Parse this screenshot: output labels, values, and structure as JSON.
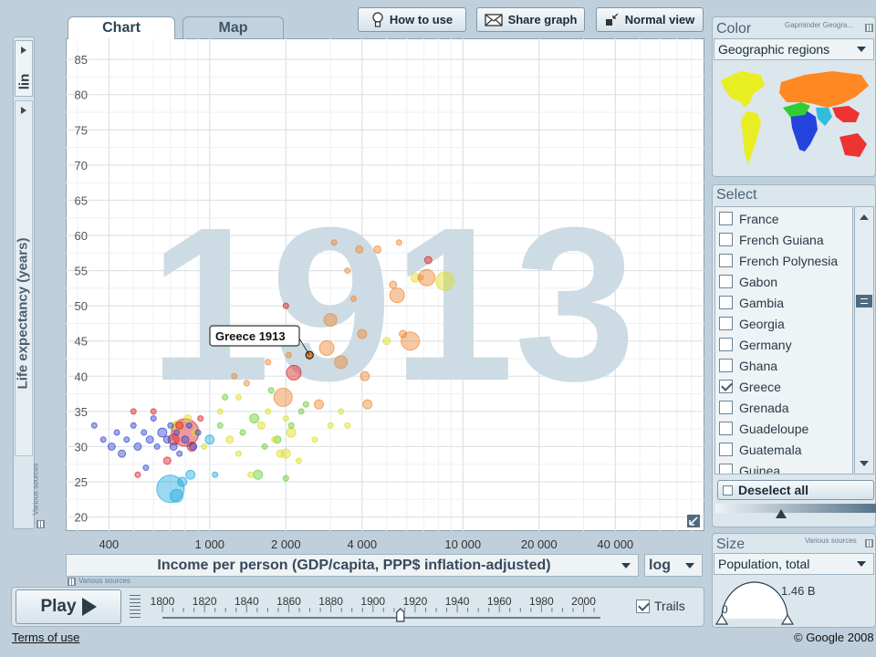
{
  "tabs": [
    {
      "label": "Chart",
      "active": true
    },
    {
      "label": "Map",
      "active": false
    }
  ],
  "toolbar": {
    "how_to_use": "How to use",
    "share_graph": "Share graph",
    "normal_view": "Normal view"
  },
  "y_scale": "lin",
  "x_scale": "log",
  "big_year": "1913",
  "tooltip": "Greece 1913",
  "sources_label": "Various sources",
  "chart_data": {
    "type": "scatter",
    "xlabel": "Income per person (GDP/capita, PPP$ inflation-adjusted)",
    "ylabel": "Life expectancy (years)",
    "x_scale": "log",
    "xlim": [
      270,
      90000
    ],
    "ylim": [
      18,
      88
    ],
    "x_ticks": [
      400,
      1000,
      2000,
      4000,
      10000,
      20000,
      40000
    ],
    "x_tick_labels": [
      "400",
      "1 000",
      "2 000",
      "4 000",
      "10 000",
      "20 000",
      "40 000"
    ],
    "y_ticks": [
      20,
      25,
      30,
      35,
      40,
      45,
      50,
      55,
      60,
      65,
      70,
      75,
      80,
      85
    ],
    "grid": true,
    "highlight": {
      "name": "Greece",
      "x": 2480,
      "y": 43
    },
    "points": [
      {
        "x": 350,
        "y": 33,
        "r": 3,
        "c": "#3344cc"
      },
      {
        "x": 380,
        "y": 31,
        "r": 3,
        "c": "#3344cc"
      },
      {
        "x": 410,
        "y": 30,
        "r": 4,
        "c": "#3344cc"
      },
      {
        "x": 430,
        "y": 32,
        "r": 3,
        "c": "#3344cc"
      },
      {
        "x": 450,
        "y": 29,
        "r": 4,
        "c": "#3344cc"
      },
      {
        "x": 470,
        "y": 31,
        "r": 3,
        "c": "#3344cc"
      },
      {
        "x": 500,
        "y": 33,
        "r": 3,
        "c": "#3344cc"
      },
      {
        "x": 520,
        "y": 30,
        "r": 4,
        "c": "#3344cc"
      },
      {
        "x": 550,
        "y": 32,
        "r": 3,
        "c": "#3344cc"
      },
      {
        "x": 580,
        "y": 31,
        "r": 4,
        "c": "#3344cc"
      },
      {
        "x": 600,
        "y": 34,
        "r": 3,
        "c": "#3344cc"
      },
      {
        "x": 620,
        "y": 30,
        "r": 3,
        "c": "#3344cc"
      },
      {
        "x": 650,
        "y": 32,
        "r": 5,
        "c": "#3344cc"
      },
      {
        "x": 680,
        "y": 31,
        "r": 4,
        "c": "#3344cc"
      },
      {
        "x": 700,
        "y": 33,
        "r": 3,
        "c": "#3344cc"
      },
      {
        "x": 720,
        "y": 30,
        "r": 4,
        "c": "#3344cc"
      },
      {
        "x": 740,
        "y": 32,
        "r": 3,
        "c": "#3344cc"
      },
      {
        "x": 760,
        "y": 29,
        "r": 3,
        "c": "#3344cc"
      },
      {
        "x": 800,
        "y": 31,
        "r": 4,
        "c": "#3344cc"
      },
      {
        "x": 830,
        "y": 33,
        "r": 3,
        "c": "#3344cc"
      },
      {
        "x": 860,
        "y": 30,
        "r": 4,
        "c": "#3344cc"
      },
      {
        "x": 900,
        "y": 32,
        "r": 3,
        "c": "#3344cc"
      },
      {
        "x": 560,
        "y": 27,
        "r": 3,
        "c": "#3344cc"
      },
      {
        "x": 600,
        "y": 35,
        "r": 3,
        "c": "#dd2222"
      },
      {
        "x": 680,
        "y": 28,
        "r": 4,
        "c": "#dd2222"
      },
      {
        "x": 720,
        "y": 31,
        "r": 6,
        "c": "#dd2222"
      },
      {
        "x": 760,
        "y": 33,
        "r": 4,
        "c": "#dd2222"
      },
      {
        "x": 800,
        "y": 32,
        "r": 15,
        "c": "#dd2222"
      },
      {
        "x": 850,
        "y": 30,
        "r": 5,
        "c": "#dd2222"
      },
      {
        "x": 920,
        "y": 34,
        "r": 3,
        "c": "#dd2222"
      },
      {
        "x": 500,
        "y": 35,
        "r": 3,
        "c": "#dd2222"
      },
      {
        "x": 520,
        "y": 26,
        "r": 3,
        "c": "#dd2222"
      },
      {
        "x": 700,
        "y": 24,
        "r": 15,
        "c": "#22aadd"
      },
      {
        "x": 740,
        "y": 23,
        "r": 7,
        "c": "#22aadd"
      },
      {
        "x": 780,
        "y": 25,
        "r": 5,
        "c": "#22aadd"
      },
      {
        "x": 840,
        "y": 26,
        "r": 5,
        "c": "#22aadd"
      },
      {
        "x": 1000,
        "y": 31,
        "r": 5,
        "c": "#22aadd"
      },
      {
        "x": 1050,
        "y": 26,
        "r": 3,
        "c": "#22aadd"
      },
      {
        "x": 740,
        "y": 33,
        "r": 5,
        "c": "#dddd22"
      },
      {
        "x": 820,
        "y": 34,
        "r": 4,
        "c": "#dddd22"
      },
      {
        "x": 880,
        "y": 32,
        "r": 4,
        "c": "#dddd22"
      },
      {
        "x": 950,
        "y": 30,
        "r": 3,
        "c": "#dddd22"
      },
      {
        "x": 1100,
        "y": 35,
        "r": 3,
        "c": "#dddd22"
      },
      {
        "x": 1200,
        "y": 31,
        "r": 4,
        "c": "#dddd22"
      },
      {
        "x": 1300,
        "y": 29,
        "r": 3,
        "c": "#dddd22"
      },
      {
        "x": 1450,
        "y": 26,
        "r": 3,
        "c": "#dddd22"
      },
      {
        "x": 1600,
        "y": 33,
        "r": 4,
        "c": "#dddd22"
      },
      {
        "x": 1700,
        "y": 35,
        "r": 3,
        "c": "#dddd22"
      },
      {
        "x": 1800,
        "y": 31,
        "r": 3,
        "c": "#dddd22"
      },
      {
        "x": 1900,
        "y": 29,
        "r": 4,
        "c": "#dddd22"
      },
      {
        "x": 2000,
        "y": 34,
        "r": 3,
        "c": "#dddd22"
      },
      {
        "x": 2100,
        "y": 32,
        "r": 5,
        "c": "#dddd22"
      },
      {
        "x": 2250,
        "y": 28,
        "r": 3,
        "c": "#dddd22"
      },
      {
        "x": 2600,
        "y": 31,
        "r": 3,
        "c": "#dddd22"
      },
      {
        "x": 3000,
        "y": 33,
        "r": 3,
        "c": "#dddd22"
      },
      {
        "x": 3300,
        "y": 35,
        "r": 3,
        "c": "#dddd22"
      },
      {
        "x": 3500,
        "y": 33,
        "r": 3,
        "c": "#dddd22"
      },
      {
        "x": 2000,
        "y": 29,
        "r": 5,
        "c": "#dddd22"
      },
      {
        "x": 1300,
        "y": 37,
        "r": 3,
        "c": "#dddd22"
      },
      {
        "x": 5000,
        "y": 45,
        "r": 4,
        "c": "#dddd22"
      },
      {
        "x": 6500,
        "y": 54,
        "r": 5,
        "c": "#dddd22"
      },
      {
        "x": 8500,
        "y": 53.5,
        "r": 10,
        "c": "#dddd22"
      },
      {
        "x": 1100,
        "y": 33,
        "r": 3,
        "c": "#66cc33"
      },
      {
        "x": 1350,
        "y": 32,
        "r": 3,
        "c": "#66cc33"
      },
      {
        "x": 1500,
        "y": 34,
        "r": 5,
        "c": "#66cc33"
      },
      {
        "x": 1650,
        "y": 30,
        "r": 3,
        "c": "#66cc33"
      },
      {
        "x": 1750,
        "y": 38,
        "r": 3,
        "c": "#66cc33"
      },
      {
        "x": 1850,
        "y": 31,
        "r": 4,
        "c": "#66cc33"
      },
      {
        "x": 2100,
        "y": 33,
        "r": 3,
        "c": "#66cc33"
      },
      {
        "x": 2300,
        "y": 35,
        "r": 3,
        "c": "#66cc33"
      },
      {
        "x": 1550,
        "y": 26,
        "r": 5,
        "c": "#66cc33"
      },
      {
        "x": 2000,
        "y": 25.5,
        "r": 3,
        "c": "#66cc33"
      },
      {
        "x": 1150,
        "y": 37,
        "r": 3,
        "c": "#66cc33"
      },
      {
        "x": 2400,
        "y": 36,
        "r": 3,
        "c": "#66cc33"
      },
      {
        "x": 1250,
        "y": 40,
        "r": 3,
        "c": "#ee8833"
      },
      {
        "x": 1400,
        "y": 39,
        "r": 3,
        "c": "#ee8833"
      },
      {
        "x": 1700,
        "y": 42,
        "r": 3,
        "c": "#ee8833"
      },
      {
        "x": 1950,
        "y": 37,
        "r": 10,
        "c": "#ee8833"
      },
      {
        "x": 2050,
        "y": 43,
        "r": 3,
        "c": "#ee8833"
      },
      {
        "x": 2700,
        "y": 36,
        "r": 5,
        "c": "#ee8833"
      },
      {
        "x": 2900,
        "y": 44,
        "r": 8,
        "c": "#ee8833"
      },
      {
        "x": 3000,
        "y": 48,
        "r": 7,
        "c": "#ee8833"
      },
      {
        "x": 3100,
        "y": 59,
        "r": 3,
        "c": "#ee8833"
      },
      {
        "x": 3300,
        "y": 42,
        "r": 7,
        "c": "#ee8833"
      },
      {
        "x": 3500,
        "y": 55,
        "r": 3,
        "c": "#ee8833"
      },
      {
        "x": 3700,
        "y": 51,
        "r": 3,
        "c": "#ee8833"
      },
      {
        "x": 3900,
        "y": 58,
        "r": 4,
        "c": "#ee8833"
      },
      {
        "x": 4000,
        "y": 46,
        "r": 5,
        "c": "#ee8833"
      },
      {
        "x": 4100,
        "y": 40,
        "r": 5,
        "c": "#ee8833"
      },
      {
        "x": 4200,
        "y": 36,
        "r": 5,
        "c": "#ee8833"
      },
      {
        "x": 4600,
        "y": 58,
        "r": 4,
        "c": "#ee8833"
      },
      {
        "x": 5300,
        "y": 53,
        "r": 4,
        "c": "#ee8833"
      },
      {
        "x": 5500,
        "y": 51.5,
        "r": 8,
        "c": "#ee8833"
      },
      {
        "x": 5800,
        "y": 46,
        "r": 4,
        "c": "#ee8833"
      },
      {
        "x": 6200,
        "y": 45,
        "r": 10,
        "c": "#ee8833"
      },
      {
        "x": 6800,
        "y": 54,
        "r": 3,
        "c": "#ee8833"
      },
      {
        "x": 7200,
        "y": 54,
        "r": 9,
        "c": "#ee8833"
      },
      {
        "x": 5600,
        "y": 59,
        "r": 3,
        "c": "#ee8833"
      },
      {
        "x": 2480,
        "y": 43,
        "r": 4,
        "c": "#ee8833"
      },
      {
        "x": 7300,
        "y": 56.5,
        "r": 4,
        "c": "#dd2222"
      },
      {
        "x": 2150,
        "y": 40.5,
        "r": 8,
        "c": "#dd2222"
      },
      {
        "x": 2000,
        "y": 50,
        "r": 3,
        "c": "#dd2222"
      }
    ]
  },
  "color_panel": {
    "title": "Color",
    "source": "Gapminder Geogra...",
    "selected": "Geographic regions",
    "map_colors": [
      "#e8ee22",
      "#2244dd",
      "#33cc33",
      "#ff8822",
      "#33bbdd",
      "#ee3333"
    ]
  },
  "select_panel": {
    "title": "Select",
    "items": [
      {
        "label": "France",
        "checked": false
      },
      {
        "label": "French Guiana",
        "checked": false
      },
      {
        "label": "French Polynesia",
        "checked": false
      },
      {
        "label": "Gabon",
        "checked": false
      },
      {
        "label": "Gambia",
        "checked": false
      },
      {
        "label": "Georgia",
        "checked": false
      },
      {
        "label": "Germany",
        "checked": false
      },
      {
        "label": "Ghana",
        "checked": false
      },
      {
        "label": "Greece",
        "checked": true
      },
      {
        "label": "Grenada",
        "checked": false
      },
      {
        "label": "Guadeloupe",
        "checked": false
      },
      {
        "label": "Guatemala",
        "checked": false
      },
      {
        "label": "Guinea",
        "checked": false
      }
    ],
    "deselect_all": "Deselect all"
  },
  "size_panel": {
    "title": "Size",
    "source": "Various sources",
    "selected": "Population, total",
    "max_label": "1.46 B",
    "min_label": "0"
  },
  "timeline": {
    "play_label": "Play",
    "years": [
      "1800",
      "1820",
      "1840",
      "1860",
      "1880",
      "1900",
      "1920",
      "1940",
      "1960",
      "1980",
      "2000"
    ],
    "start": 1800,
    "end": 2008,
    "current": 1913,
    "trails_label": "Trails",
    "trails_checked": true
  },
  "footer": {
    "terms": "Terms of use",
    "copyright": "© Google 2008"
  }
}
